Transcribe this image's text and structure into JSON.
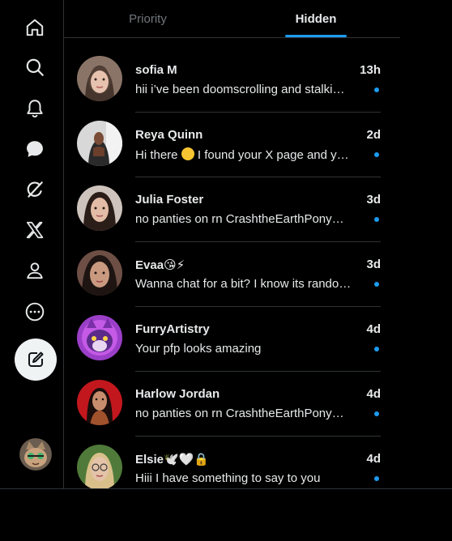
{
  "nav": {
    "items": [
      {
        "icon": "home-icon"
      },
      {
        "icon": "search-icon"
      },
      {
        "icon": "notifications-icon"
      },
      {
        "icon": "messages-icon"
      },
      {
        "icon": "grok-icon"
      },
      {
        "icon": "x-logo-icon"
      },
      {
        "icon": "profile-icon"
      },
      {
        "icon": "more-icon"
      }
    ],
    "compose_icon": "compose-icon"
  },
  "tabs": [
    {
      "label": "Priority",
      "active": false
    },
    {
      "label": "Hidden",
      "active": true
    }
  ],
  "colors": {
    "background": "#000000",
    "accent": "#1d9bf0",
    "text": "#e7e9ea",
    "muted": "#71767b",
    "divider": "#2f3336"
  },
  "conversations": [
    {
      "name": "sofia M",
      "time": "13h",
      "preview": "hii i’ve been doomscrolling and stalki…",
      "unread": true
    },
    {
      "name": "Reya Quinn",
      "time": "2d",
      "preview_before": "Hi there ",
      "preview_emoji": "smiling-face-emoji",
      "preview_after": " I found your X page and y…",
      "unread": true
    },
    {
      "name": "Julia Foster",
      "time": "3d",
      "preview": "no panties on rn CrashtheEarthPony…",
      "unread": true
    },
    {
      "name": "Evaa😘⚡",
      "time": "3d",
      "preview": "Wanna chat for a bit? I know its rando…",
      "unread": true
    },
    {
      "name": "FurryArtistry",
      "time": "4d",
      "preview": "Your pfp looks amazing",
      "unread": true
    },
    {
      "name": "Harlow Jordan",
      "time": "4d",
      "preview": "no panties on rn CrashtheEarthPony…",
      "unread": true
    },
    {
      "name": "Elsie🕊️🤍🔒",
      "time": "4d",
      "preview": "Hiii I have something to say to you",
      "unread": true
    }
  ]
}
